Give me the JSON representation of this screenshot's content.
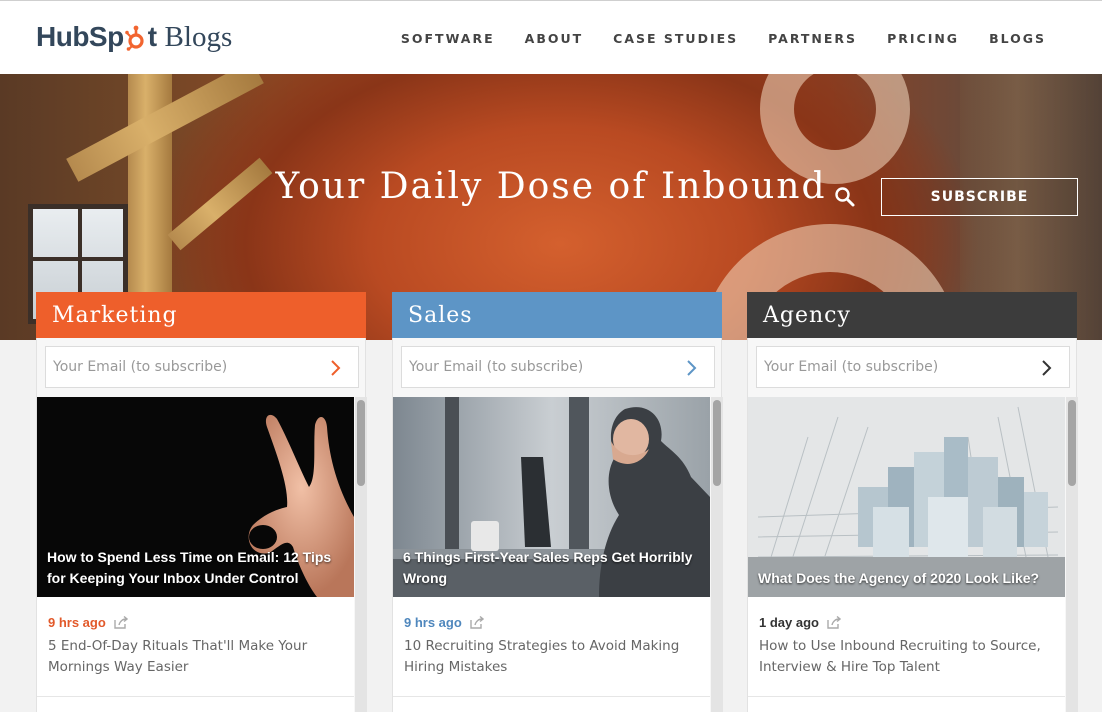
{
  "brand": {
    "logo_hub": "HubSp",
    "logo_t": "t",
    "logo_blogs": "Blogs",
    "orange": "#f26530",
    "navy": "#33475b"
  },
  "nav": {
    "items": [
      "SOFTWARE",
      "ABOUT",
      "CASE STUDIES",
      "PARTNERS",
      "PRICING",
      "BLOGS"
    ]
  },
  "hero": {
    "title": "Your Daily Dose of Inbound",
    "subscribe_label": "SUBSCRIBE",
    "search_icon": "search-icon"
  },
  "columns": [
    {
      "name": "Marketing",
      "color": "#ee5f2b",
      "email_placeholder": "Your Email (to subscribe)",
      "feature_title": "How to Spend Less Time on Email: 12 Tips for Keeping Your Inbox Under Control",
      "post_time": "9 hrs ago",
      "post_time_color": "#e2592a",
      "post_title": "5 End-Of-Day Rituals That'll Make Your Mornings Way Easier"
    },
    {
      "name": "Sales",
      "color": "#5d95c6",
      "email_placeholder": "Your Email (to subscribe)",
      "feature_title": "6 Things First-Year Sales Reps Get Horribly Wrong",
      "post_time": "9 hrs ago",
      "post_time_color": "#4f87bd",
      "post_title": "10 Recruiting Strategies to Avoid Making Hiring Mistakes"
    },
    {
      "name": "Agency",
      "color": "#3c3c3c",
      "email_placeholder": "Your Email (to subscribe)",
      "feature_title": "What Does the Agency of 2020 Look Like?",
      "post_time": "1 day ago",
      "post_time_color": "#333333",
      "post_title": "How to Use Inbound Recruiting to Source, Interview & Hire Top Talent"
    }
  ]
}
